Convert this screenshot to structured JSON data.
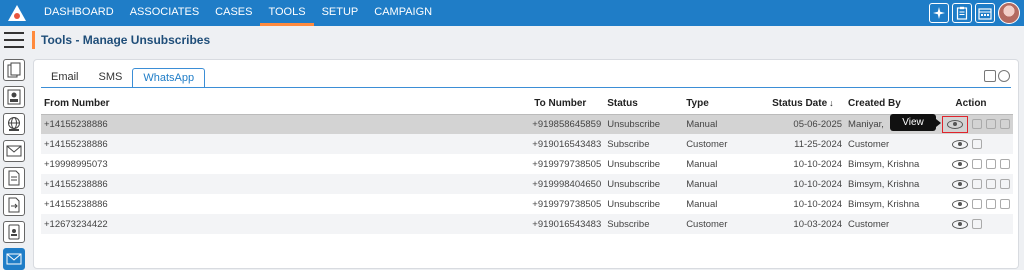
{
  "nav": {
    "items": [
      "DASHBOARD",
      "ASSOCIATES",
      "CASES",
      "TOOLS",
      "SETUP",
      "CAMPAIGN"
    ],
    "active_index": 3
  },
  "page": {
    "title": "Tools - Manage Unsubscribes"
  },
  "tabs": {
    "items": [
      "Email",
      "SMS",
      "WhatsApp"
    ],
    "active_index": 2
  },
  "table": {
    "headers": {
      "from": "From Number",
      "to": "To Number",
      "status": "Status",
      "type": "Type",
      "status_date": "Status Date",
      "created_by": "Created By",
      "action": "Action"
    },
    "sort_arrow": "↓",
    "rows": [
      {
        "from": "+14155238886",
        "to": "+919858645859",
        "status": "Unsubscribe",
        "type": "Manual",
        "date": "05-06-2025",
        "created_by": "Maniyar,"
      },
      {
        "from": "+14155238886",
        "to": "+919016543483",
        "status": "Subscribe",
        "type": "Customer",
        "date": "11-25-2024",
        "created_by": "Customer"
      },
      {
        "from": "+19998995073",
        "to": "+919979738505",
        "status": "Unsubscribe",
        "type": "Manual",
        "date": "10-10-2024",
        "created_by": "Bimsym, Krishna"
      },
      {
        "from": "+14155238886",
        "to": "+919998404650",
        "status": "Unsubscribe",
        "type": "Manual",
        "date": "10-10-2024",
        "created_by": "Bimsym, Krishna"
      },
      {
        "from": "+14155238886",
        "to": "+919979738505",
        "status": "Unsubscribe",
        "type": "Manual",
        "date": "10-10-2024",
        "created_by": "Bimsym, Krishna"
      },
      {
        "from": "+12673234422",
        "to": "+919016543483",
        "status": "Subscribe",
        "type": "Customer",
        "date": "10-03-2024",
        "created_by": "Customer"
      }
    ]
  },
  "tooltip": {
    "text": "View"
  },
  "colors": {
    "nav_bg": "#1f7dc7",
    "accent": "#ff8a3d",
    "highlight_border": "#e0242c"
  }
}
